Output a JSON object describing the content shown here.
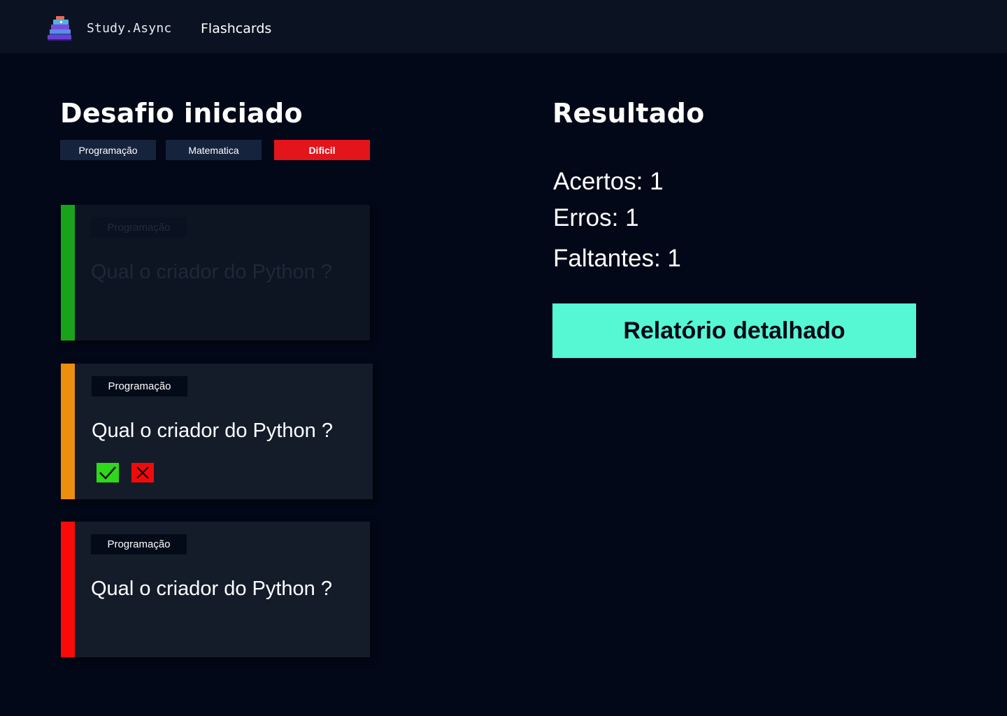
{
  "header": {
    "brand": "Study.Async",
    "nav_link": "Flashcards",
    "logo_icon": "book-stack-icon"
  },
  "challenge": {
    "title": "Desafio iniciado",
    "tags": [
      "Programação",
      "Matematica"
    ],
    "difficulty": "Dificil"
  },
  "cards": [
    {
      "status": "answered-correct",
      "stripe_color": "#1aa31a",
      "category": "Programação",
      "question": "Qual o criador do Python ?"
    },
    {
      "status": "current",
      "stripe_color": "#ec8f0e",
      "category": "Programação",
      "question": "Qual o criador do Python ?"
    },
    {
      "status": "answered-wrong",
      "stripe_color": "#fb0a0a",
      "category": "Programação",
      "question": "Qual o criador do Python ?"
    }
  ],
  "actions": {
    "correct_icon": "check-icon",
    "wrong_icon": "close-icon"
  },
  "result": {
    "title": "Resultado",
    "acertos": "Acertos: 1",
    "erros": "Erros: 1",
    "faltantes": "Faltantes: 1",
    "report_button": "Relatório detalhado"
  },
  "colors": {
    "background": "#020817",
    "topbar": "#0b1322",
    "card": "#141c2a",
    "accent": "#56f8d3",
    "difficulty": "#e4141b"
  }
}
